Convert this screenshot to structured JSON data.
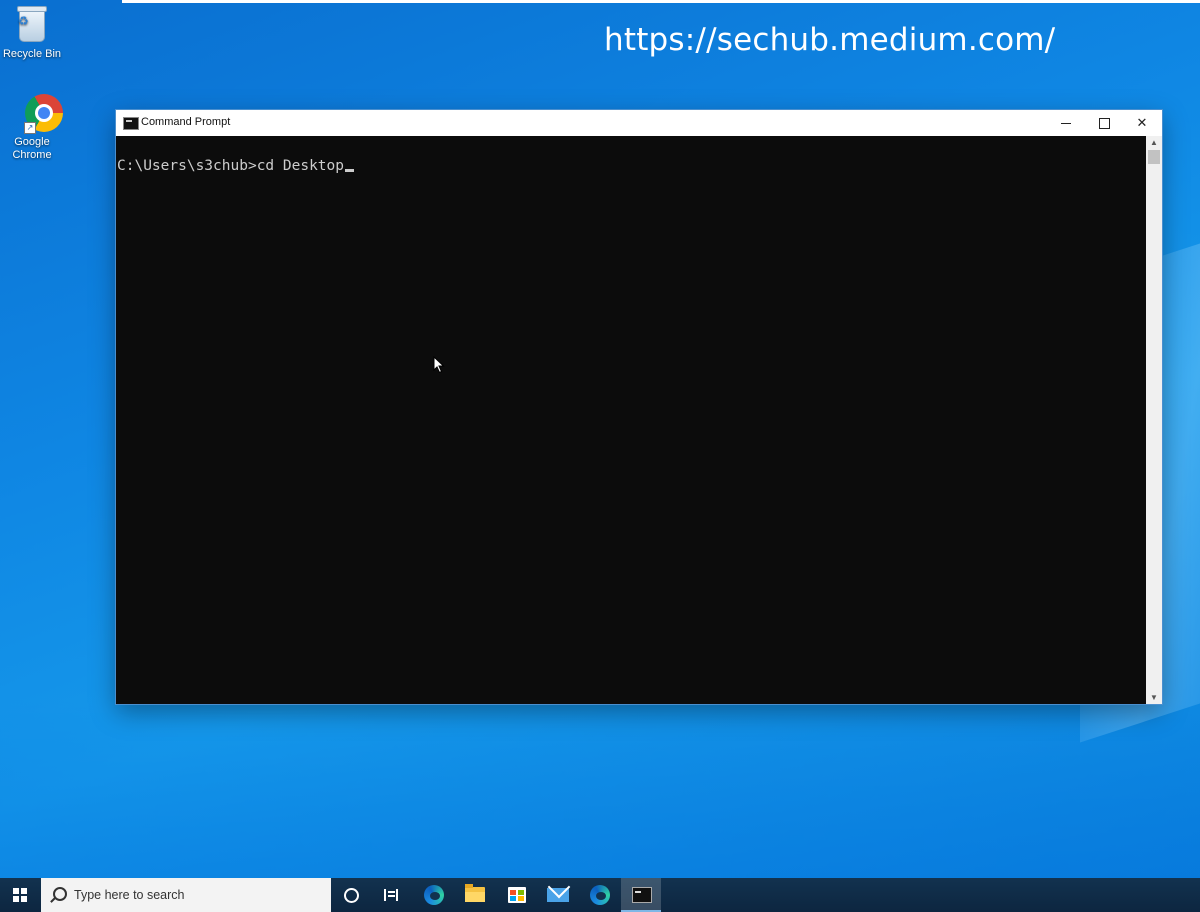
{
  "desktop": {
    "watermark": "https://sechub.medium.com/",
    "icons": [
      {
        "label": "Recycle Bin",
        "icon": "recycle-bin-icon"
      },
      {
        "label": "Google Chrome",
        "label_line1": "Google",
        "label_line2": "Chrome",
        "icon": "chrome-icon"
      }
    ]
  },
  "window": {
    "title": "Command Prompt",
    "icon": "cmd-icon",
    "controls": {
      "minimize": "minimize",
      "maximize": "maximize",
      "close": "close"
    }
  },
  "console": {
    "prompt": "C:\\Users\\s3chub>",
    "command": "cd Desktop"
  },
  "taskbar": {
    "search_placeholder": "Type here to search",
    "items": [
      {
        "name": "cortana",
        "icon": "circle-icon"
      },
      {
        "name": "task-view",
        "icon": "task-view-icon"
      },
      {
        "name": "edge",
        "icon": "edge-icon"
      },
      {
        "name": "file-explorer",
        "icon": "folder-icon"
      },
      {
        "name": "microsoft-store",
        "icon": "store-icon"
      },
      {
        "name": "mail",
        "icon": "mail-icon"
      },
      {
        "name": "edge-beta",
        "icon": "edge-icon"
      },
      {
        "name": "command-prompt",
        "icon": "cmd-icon",
        "active": true
      }
    ]
  },
  "colors": {
    "console_bg": "#0c0c0c",
    "console_text": "#cccccc",
    "desktop_blue": "#0f86e3",
    "taskbar_bg": "#12324f"
  }
}
